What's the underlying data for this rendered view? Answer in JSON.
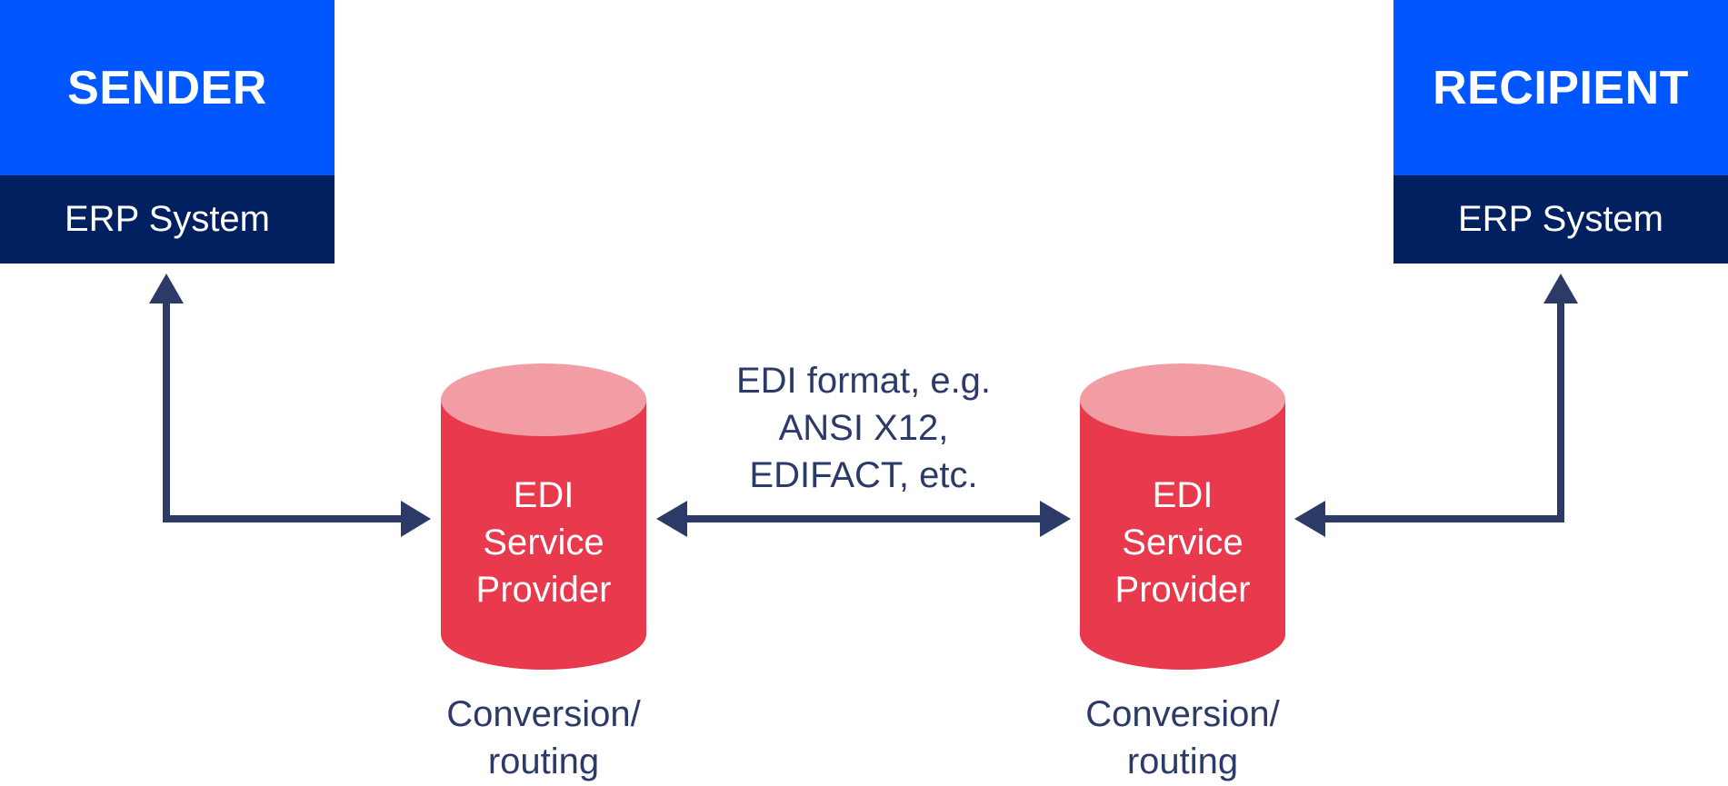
{
  "colors": {
    "party_header": "#0057ff",
    "party_system": "#00205f",
    "cylinder_body": "#e8394d",
    "cylinder_top": "#f29ca4",
    "arrow": "#2b3a67",
    "text_dark": "#2b3a67"
  },
  "sender": {
    "title": "SENDER",
    "system": "ERP System"
  },
  "recipient": {
    "title": "RECIPIENT",
    "system": "ERP System"
  },
  "providers": [
    {
      "lines": [
        "EDI",
        "Service",
        "Provider"
      ],
      "caption": [
        "Conversion/",
        "routing"
      ]
    },
    {
      "lines": [
        "EDI",
        "Service",
        "Provider"
      ],
      "caption": [
        "Conversion/",
        "routing"
      ]
    }
  ],
  "exchange_label": [
    "EDI format, e.g.",
    "ANSI X12,",
    "EDIFACT, etc."
  ],
  "connections": [
    {
      "from": "sender",
      "to": "provider-1",
      "direction": "bidirectional"
    },
    {
      "from": "provider-1",
      "to": "provider-2",
      "direction": "bidirectional"
    },
    {
      "from": "provider-2",
      "to": "recipient",
      "direction": "bidirectional"
    }
  ]
}
